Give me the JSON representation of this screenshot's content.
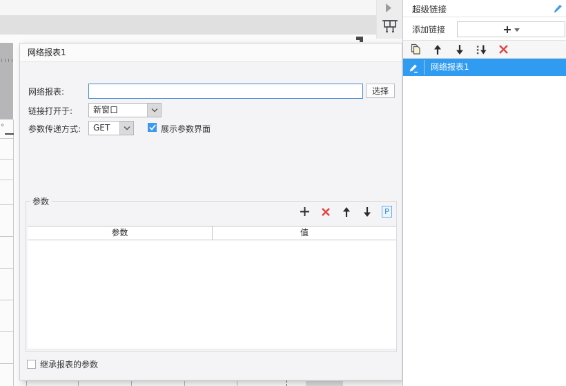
{
  "canvas": {
    "artifact": "°",
    "icons": {
      "paste_icon": "paste-with-options",
      "collapse_icon": "triangle-right",
      "component_icon": "report-component"
    }
  },
  "dialog": {
    "title": "网络报表1",
    "report_field": {
      "label": "网络报表:",
      "value": "",
      "button": "选择"
    },
    "open_field": {
      "label": "链接打开于:",
      "value": "新窗口"
    },
    "method_field": {
      "label": "参数传递方式:",
      "value": "GET"
    },
    "show_params": {
      "label": "展示参数界面",
      "checked": true
    },
    "params_group": {
      "title": "参数",
      "toolbar": {
        "p_label": "P"
      },
      "table": {
        "columns": [
          "参数",
          "值"
        ],
        "rows": []
      }
    },
    "inherit": {
      "label": "继承报表的参数",
      "checked": false
    }
  },
  "panel": {
    "title": "超级链接",
    "add_label": "添加链接",
    "add_button": "+",
    "items": [
      {
        "label": "网络报表1",
        "selected": true
      }
    ]
  },
  "colors": {
    "selection_blue": "#2f9bf1",
    "focus_border": "#3f87d2",
    "danger_red": "#e04040",
    "checkbox_blue": "#3b9af0"
  }
}
